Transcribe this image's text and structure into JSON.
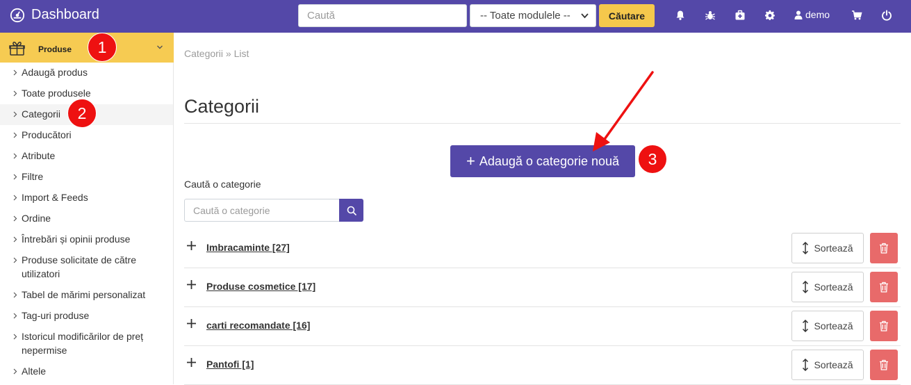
{
  "header": {
    "brand": "Dashboard",
    "search_placeholder": "Caută",
    "module_select": "-- Toate modulele --",
    "search_button": "Căutare",
    "user": "demo"
  },
  "sidebar": {
    "section_label": "Produse",
    "items": [
      {
        "label": "Adaugă produs"
      },
      {
        "label": "Toate produsele"
      },
      {
        "label": "Categorii"
      },
      {
        "label": "Producători"
      },
      {
        "label": "Atribute"
      },
      {
        "label": "Filtre"
      },
      {
        "label": "Import & Feeds"
      },
      {
        "label": "Ordine"
      },
      {
        "label": "Întrebări și opinii produse"
      },
      {
        "label": "Produse solicitate de către",
        "label2": "utilizatori"
      },
      {
        "label": "Tabel de mărimi personalizat"
      },
      {
        "label": "Tag-uri produse"
      },
      {
        "label": "Istoricul modificărilor de preț",
        "label2": "nepermise"
      },
      {
        "label": "Altele"
      }
    ]
  },
  "annotations": {
    "step1": "1",
    "step2": "2",
    "step3": "3"
  },
  "main": {
    "breadcrumb": "Categorii » List",
    "title": "Categorii",
    "add_button": "Adaugă o categorie nouă",
    "add_button_plus": "+",
    "search_label": "Caută o categorie",
    "search_placeholder": "Caută o categorie",
    "rows": [
      {
        "name": "Imbracaminte [27]",
        "sort": "Sortează"
      },
      {
        "name": "Produse cosmetice [17]",
        "sort": "Sortează"
      },
      {
        "name": "carti recomandate [16]",
        "sort": "Sortează"
      },
      {
        "name": "Pantofi [1]",
        "sort": "Sortează"
      }
    ]
  },
  "colors": {
    "primary": "#5448a8",
    "accent": "#f5c84c",
    "danger": "#e86a6a",
    "annotation": "#ee1111"
  },
  "icons": [
    "dashboard-icon",
    "bell-icon",
    "bug-icon",
    "medkit-icon",
    "gear-icon",
    "user-icon",
    "cart-icon",
    "power-icon",
    "gift-icon",
    "chevron-down-icon",
    "chevron-right-icon",
    "search-icon",
    "plus-icon",
    "sort-icon",
    "trash-icon",
    "arrow-annotation-icon"
  ]
}
